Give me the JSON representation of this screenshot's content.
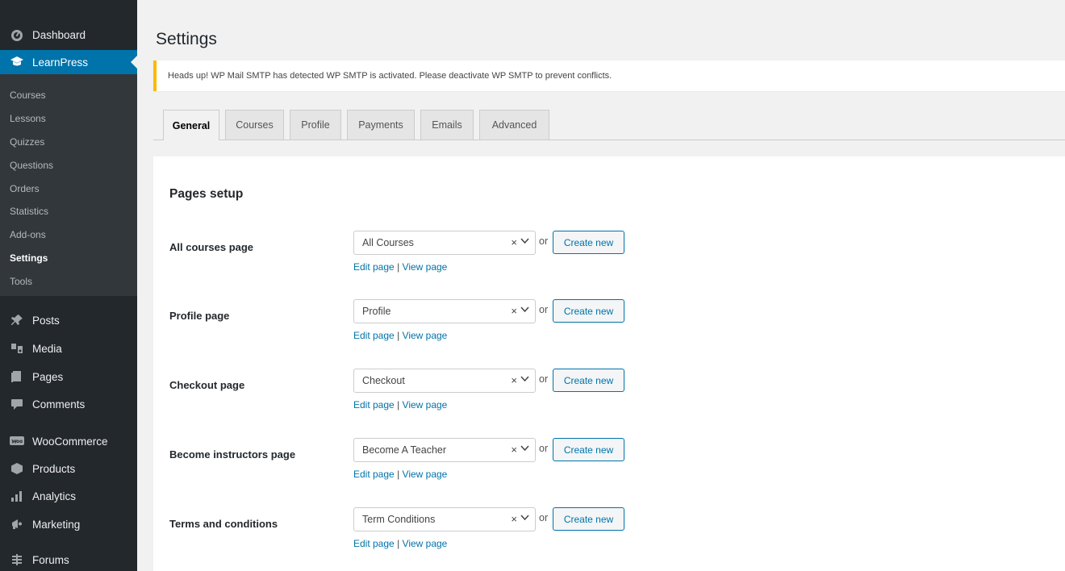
{
  "sidebar": {
    "dashboard": {
      "label": "Dashboard",
      "icon": "dashboard-icon"
    },
    "learnpress": {
      "label": "LearnPress",
      "icon": "graduation-cap-icon",
      "active_color": "#0073aa"
    },
    "submenu": [
      "Courses",
      "Lessons",
      "Quizzes",
      "Questions",
      "Orders",
      "Statistics",
      "Add-ons",
      "Settings",
      "Tools"
    ],
    "active_submenu": "Settings",
    "menu": [
      {
        "label": "Posts",
        "icon": "pin-icon"
      },
      {
        "label": "Media",
        "icon": "media-icon"
      },
      {
        "label": "Pages",
        "icon": "pages-icon"
      },
      {
        "label": "Comments",
        "icon": "comment-icon"
      },
      {
        "label": "WooCommerce",
        "icon": "woocommerce-icon"
      },
      {
        "label": "Products",
        "icon": "archive-icon"
      },
      {
        "label": "Analytics",
        "icon": "chart-bar-icon"
      },
      {
        "label": "Marketing",
        "icon": "megaphone-icon"
      },
      {
        "label": "Forums",
        "icon": "forums-icon"
      }
    ]
  },
  "page": {
    "title": "Settings",
    "notice": "Heads up! WP Mail SMTP has detected WP SMTP is activated. Please deactivate WP SMTP to prevent conflicts.",
    "notice_color": "#ffb900"
  },
  "tabs": [
    "General",
    "Courses",
    "Profile",
    "Payments",
    "Emails",
    "Advanced"
  ],
  "active_tab": "General",
  "section": {
    "title": "Pages setup",
    "or_text": "or",
    "create_label": "Create new",
    "edit_label": "Edit page",
    "separator": "|",
    "view_label": "View page",
    "clear_glyph": "×",
    "rows": [
      {
        "label": "All courses page",
        "value": "All Courses"
      },
      {
        "label": "Profile page",
        "value": "Profile"
      },
      {
        "label": "Checkout page",
        "value": "Checkout"
      },
      {
        "label": "Become instructors page",
        "value": "Become A Teacher"
      },
      {
        "label": "Terms and conditions",
        "value": "Term Conditions"
      }
    ]
  }
}
